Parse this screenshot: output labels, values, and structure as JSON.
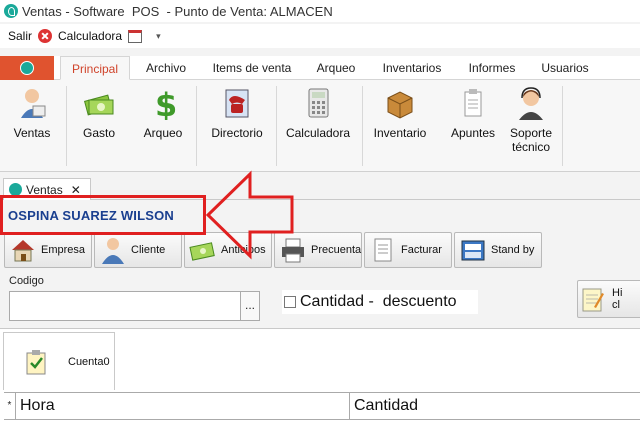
{
  "window": {
    "title": "Ventas - Software  POS  - Punto de Venta: ALMACEN"
  },
  "quick_access": {
    "exit_label": "Salir",
    "calculator_label": "Calculadora",
    "dropdown_glyph": "▾"
  },
  "ribbon": {
    "tabs": [
      "Principal",
      "Archivo",
      "Items de venta",
      "Arqueo",
      "Inventarios",
      "Informes",
      "Usuarios"
    ],
    "active_tab": "Principal",
    "buttons": [
      {
        "label": "Ventas",
        "icon": "cashier-icon"
      },
      {
        "label": "Gasto",
        "icon": "money-stack-icon"
      },
      {
        "label": "Arqueo",
        "icon": "dollar-icon"
      },
      {
        "label": "Directorio",
        "icon": "phone-book-icon"
      },
      {
        "label": "Calculadora",
        "icon": "calculator-icon"
      },
      {
        "label": "Inventario",
        "icon": "box-icon"
      },
      {
        "label": "Apuntes",
        "icon": "notes-icon"
      },
      {
        "label": "Soporte técnico",
        "icon": "support-agent-icon"
      }
    ]
  },
  "document_tab": {
    "label": "Ventas",
    "close_glyph": "✕"
  },
  "sale": {
    "customer_name": "OSPINA SUAREZ WILSON",
    "toolbar": [
      {
        "label": "Empresa",
        "icon": "house-icon"
      },
      {
        "label": "Cliente",
        "icon": "person-icon"
      },
      {
        "label": "Anticipos",
        "icon": "money-icon"
      },
      {
        "label": "Precuenta",
        "icon": "printer-icon"
      },
      {
        "label": "Facturar",
        "icon": "invoice-icon"
      },
      {
        "label": "Stand by",
        "icon": "archive-icon"
      }
    ],
    "codigo_label": "Codigo",
    "codigo_value": "",
    "dots_button": "...",
    "cantidad_checkbox_label": "Cantidad -  descuento",
    "cantidad_checked": false,
    "history_button": "Hi\ncl",
    "account_tab": "Cuenta0",
    "grid": {
      "new_row_marker": "*",
      "columns": [
        "Hora",
        "Cantidad"
      ]
    }
  },
  "colors": {
    "accent_orange": "#e0532f",
    "active_tab_text": "#d0432a",
    "customer_text": "#1a3f8f",
    "annotation_red": "#e02020",
    "app_teal": "#1aa99a"
  }
}
